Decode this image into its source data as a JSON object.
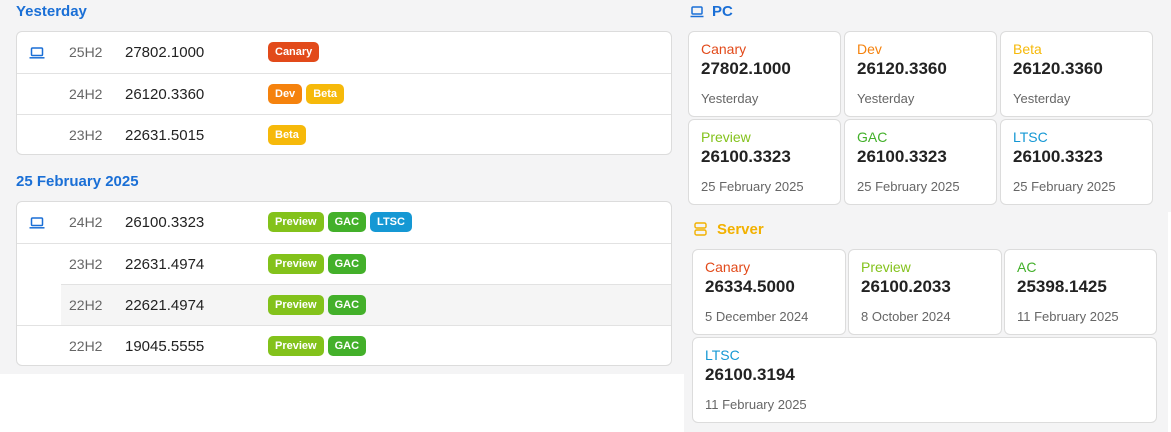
{
  "colors": {
    "canary": "#e24a1a",
    "dev": "#f5820d",
    "beta": "#f6b90a",
    "preview": "#83c21b",
    "gac": "#43b02a",
    "ltsc": "#1598d4",
    "link_blue": "#1a6fd6",
    "server_gold": "#f2b100"
  },
  "history": [
    {
      "date": "Yesterday",
      "rows": [
        {
          "version": "25H2",
          "build": "27802.1000",
          "channels": [
            "Canary"
          ],
          "icon": "laptop-icon"
        },
        {
          "version": "24H2",
          "build": "26120.3360",
          "channels": [
            "Dev",
            "Beta"
          ]
        },
        {
          "version": "23H2",
          "build": "22631.5015",
          "channels": [
            "Beta"
          ]
        }
      ]
    },
    {
      "date": "25 February 2025",
      "rows": [
        {
          "version": "24H2",
          "build": "26100.3323",
          "channels": [
            "Preview",
            "GAC",
            "LTSC"
          ],
          "icon": "laptop-icon"
        },
        {
          "version": "23H2",
          "build": "22631.4974",
          "channels": [
            "Preview",
            "GAC"
          ]
        },
        {
          "version": "22H2",
          "build": "22621.4974",
          "channels": [
            "Preview",
            "GAC"
          ]
        },
        {
          "version": "22H2",
          "build": "19045.5555",
          "channels": [
            "Preview",
            "GAC"
          ]
        }
      ]
    }
  ],
  "pc": {
    "title": "PC",
    "icon": "laptop-icon",
    "tiles": [
      {
        "channel": "Canary",
        "build": "27802.1000",
        "date": "Yesterday"
      },
      {
        "channel": "Dev",
        "build": "26120.3360",
        "date": "Yesterday"
      },
      {
        "channel": "Beta",
        "build": "26120.3360",
        "date": "Yesterday"
      },
      {
        "channel": "Preview",
        "build": "26100.3323",
        "date": "25 February 2025"
      },
      {
        "channel": "GAC",
        "build": "26100.3323",
        "date": "25 February 2025"
      },
      {
        "channel": "LTSC",
        "build": "26100.3323",
        "date": "25 February 2025"
      }
    ]
  },
  "server": {
    "title": "Server",
    "icon": "server-icon",
    "tiles": [
      {
        "channel": "Canary",
        "build": "26334.5000",
        "date": "5 December 2024"
      },
      {
        "channel": "Preview",
        "build": "26100.2033",
        "date": "8 October 2024"
      },
      {
        "channel": "AC",
        "build": "25398.1425",
        "date": "11 February 2025"
      },
      {
        "channel": "LTSC",
        "build": "26100.3194",
        "date": "11 February 2025"
      }
    ]
  }
}
